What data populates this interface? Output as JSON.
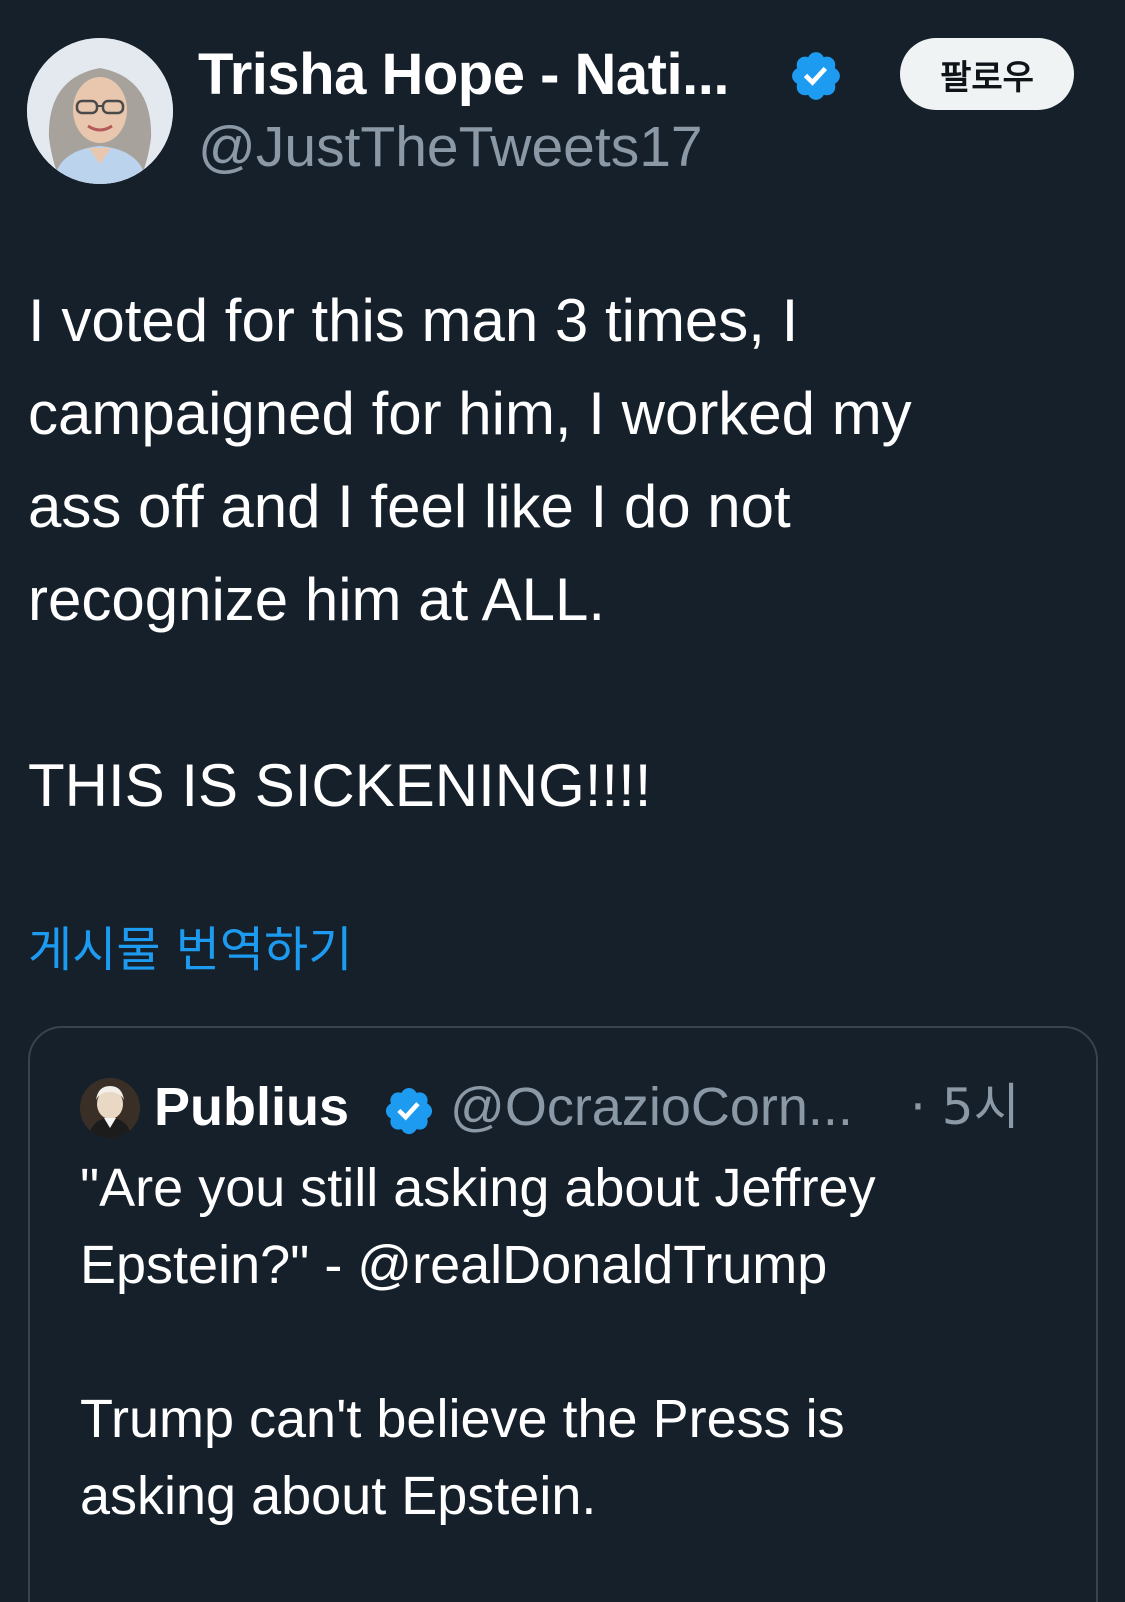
{
  "author": {
    "display_name": "Trisha Hope - Nati...",
    "handle": "@JustTheTweets17",
    "verified": true,
    "avatar_icon": "profile-photo"
  },
  "follow_button": {
    "label": "팔로우"
  },
  "tweet": {
    "text": "I voted for this man 3 times, I\ncampaigned for him, I worked my\nass off and I feel like I do not\nrecognize him at ALL.\n\nTHIS IS SICKENING!!!!"
  },
  "translate": {
    "label": "게시물 번역하기"
  },
  "quoted_tweet": {
    "display_name": "Publius",
    "handle": "@OcrazioCorn...",
    "time": "· 5시",
    "verified": true,
    "text": "\"Are you still asking about Jeffrey\nEpstein?\" - @realDonaldTrump\n\nTrump can't believe the Press is\nasking about Epstein."
  },
  "colors": {
    "background": "#15202b",
    "text_primary": "#ffffff",
    "text_secondary": "#8b98a5",
    "accent": "#1d9bf0",
    "verified": "#1d9bf0",
    "border": "#38444d"
  }
}
